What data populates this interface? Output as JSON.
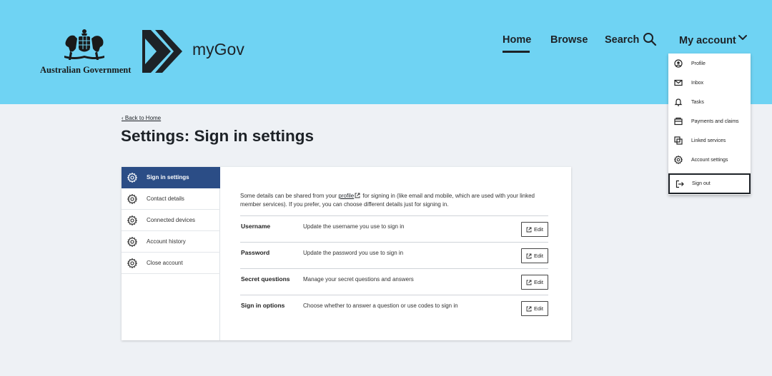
{
  "header": {
    "gov_name": "Australian Government",
    "brand": "myGov",
    "nav": {
      "home": "Home",
      "browse": "Browse",
      "search": "Search",
      "account": "My account"
    }
  },
  "account_menu": {
    "items": [
      {
        "label": "Profile",
        "icon": "user-circle-icon"
      },
      {
        "label": "Inbox",
        "icon": "mail-icon"
      },
      {
        "label": "Tasks",
        "icon": "bell-icon"
      },
      {
        "label": "Payments and claims",
        "icon": "wallet-icon"
      },
      {
        "label": "Linked services",
        "icon": "linked-icon"
      },
      {
        "label": "Account settings",
        "icon": "gear-icon"
      }
    ],
    "sign_out": "Sign out"
  },
  "breadcrumb": {
    "back": "‹ Back to Home"
  },
  "page": {
    "title_prefix": "Settings:",
    "title_rest": " Sign in settings"
  },
  "sidebar": {
    "items": [
      {
        "label": "Sign in settings",
        "active": true
      },
      {
        "label": "Contact details",
        "active": false
      },
      {
        "label": "Connected devices",
        "active": false
      },
      {
        "label": "Account history",
        "active": false
      },
      {
        "label": "Close account",
        "active": false
      }
    ]
  },
  "main": {
    "intro_part1": "Some details can be shared from your ",
    "intro_link": "profile",
    "intro_part2": " for signing in (like email and mobile, which are used with your linked member services). If you prefer, you can choose different details just for signing in.",
    "edit_label": "Edit",
    "rows": [
      {
        "label": "Username",
        "desc": "Update the username you use to sign in"
      },
      {
        "label": "Password",
        "desc": "Update the password you use to sign in"
      },
      {
        "label": "Secret questions",
        "desc": "Manage your secret questions and answers"
      },
      {
        "label": "Sign in options",
        "desc": "Choose whether to answer a question or use codes to sign in"
      }
    ]
  },
  "colors": {
    "header_bg": "#6fd3f3",
    "active_nav": "#2b4d86",
    "page_bg": "#eef1f5"
  }
}
